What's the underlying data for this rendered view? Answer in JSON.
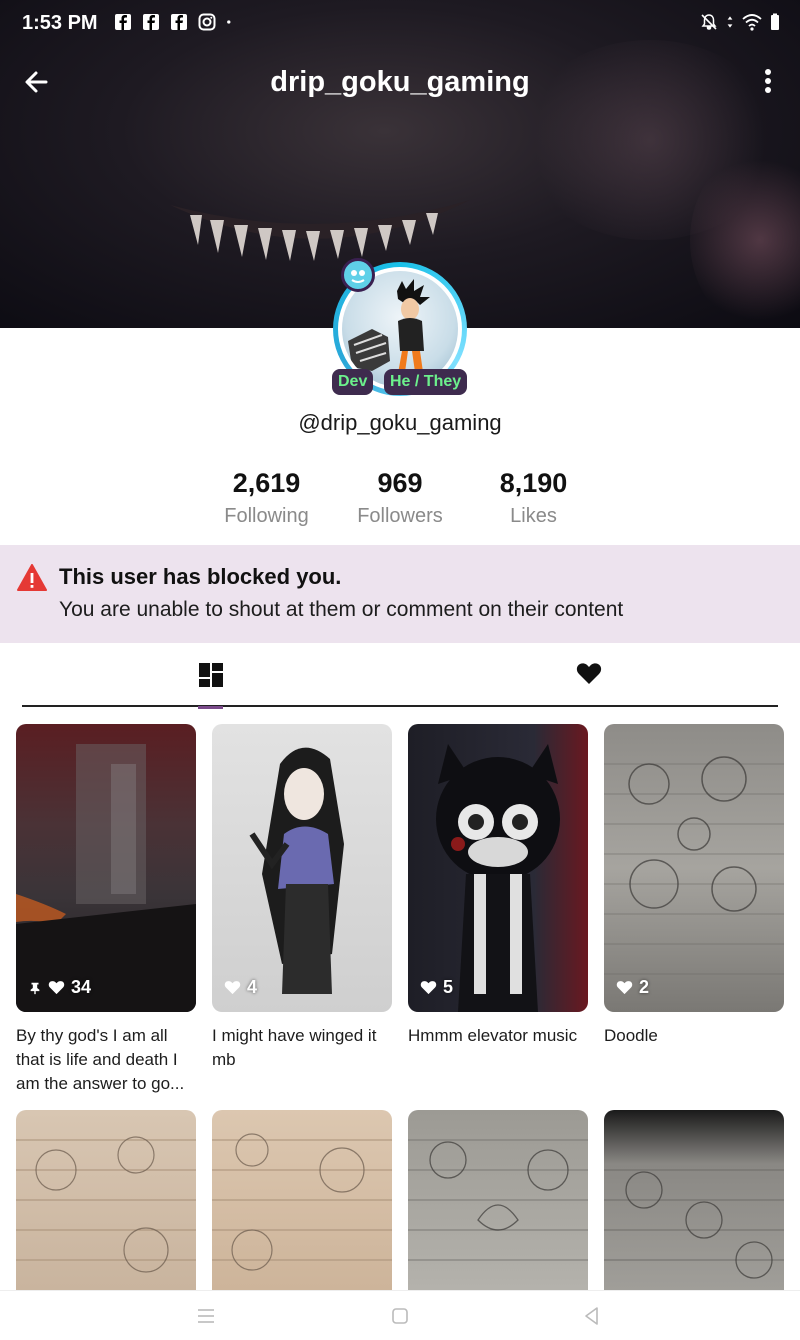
{
  "status_bar": {
    "time": "1:53 PM",
    "left_icons": [
      "facebook-icon",
      "facebook-icon",
      "facebook-icon",
      "instagram-icon",
      "dot-icon"
    ],
    "right_icons": [
      "bell-off-icon",
      "wifi-icon",
      "battery-icon"
    ]
  },
  "header": {
    "title": "drip_goku_gaming",
    "back_icon": "arrow-left-icon",
    "menu_icon": "more-vertical-icon"
  },
  "profile": {
    "tags": [
      "Dev",
      "He / They"
    ],
    "handle": "@drip_goku_gaming",
    "stats": [
      {
        "value": "2,619",
        "label": "Following"
      },
      {
        "value": "969",
        "label": "Followers"
      },
      {
        "value": "8,190",
        "label": "Likes"
      }
    ]
  },
  "notice": {
    "title": "This user has blocked you.",
    "message": "You are unable to shout at them or comment on their content",
    "icon": "warning-triangle-icon",
    "color": "#e53935"
  },
  "tabs": [
    {
      "name": "grid",
      "icon": "dashboard-grid-icon",
      "active": true
    },
    {
      "name": "likes",
      "icon": "heart-icon",
      "active": false
    }
  ],
  "posts": [
    {
      "likes": "34",
      "pinned": true,
      "title": "By thy god's I am all that is life and death I am the answer to go..."
    },
    {
      "likes": "4",
      "pinned": false,
      "title": "I might have winged it mb"
    },
    {
      "likes": "5",
      "pinned": false,
      "title": "Hmmm elevator music"
    },
    {
      "likes": "2",
      "pinned": false,
      "title": "Doodle"
    }
  ],
  "theme": {
    "accent": "#7a4a8a",
    "tag_bg": "#3e2b4e",
    "tag_text": "#6cf08c",
    "notice_bg": "#ede3ee"
  }
}
